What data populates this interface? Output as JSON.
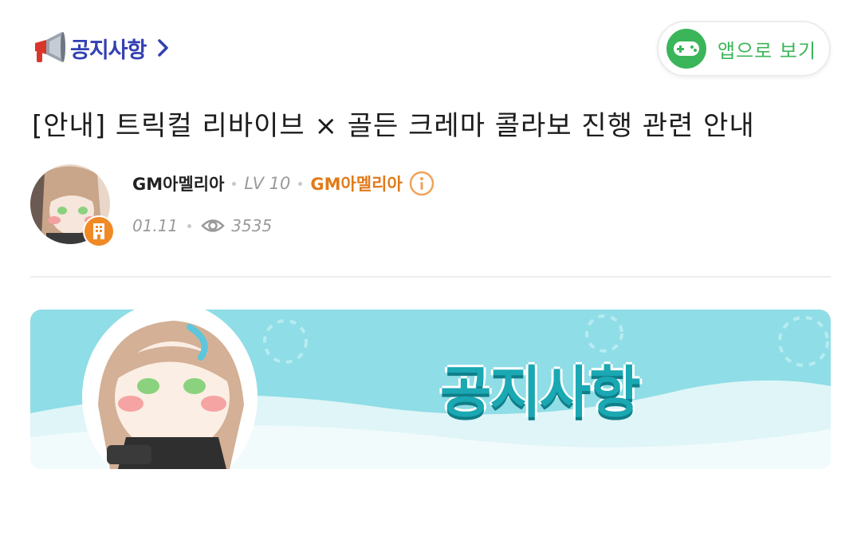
{
  "board": {
    "label": "공지사항",
    "icon": "megaphone-icon",
    "chevron_icon": "chevron-right-icon"
  },
  "app_button": {
    "label": "앱으로 보기",
    "icon": "gamepad-icon",
    "accent": "#3bb55a"
  },
  "post": {
    "title": "[안내] 트릭컬 리바이브 × 골든 크레마 콜라보 진행 관련 안내",
    "author": "GM아멜리아",
    "level": "LV 10",
    "nickname": "GM아멜리아",
    "date": "01.11",
    "views": "3535"
  },
  "banner": {
    "title": "공지사항"
  },
  "colors": {
    "board_label": "#3340b3",
    "nickname": "#e07b1a",
    "banner_bg": "#8fdde6",
    "banner_title": "#1aa8b3"
  }
}
